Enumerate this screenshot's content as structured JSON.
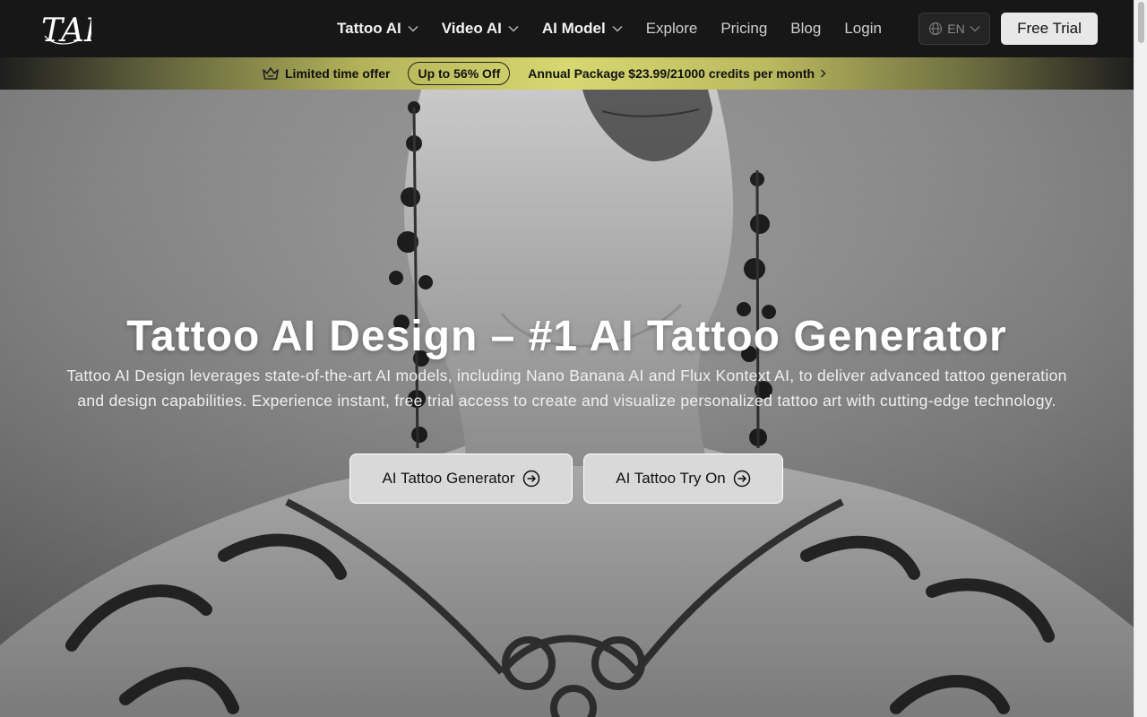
{
  "header": {
    "logo_text": "TAI",
    "nav": [
      {
        "label": "Tattoo AI",
        "has_dropdown": true
      },
      {
        "label": "Video AI",
        "has_dropdown": true
      },
      {
        "label": "AI Model",
        "has_dropdown": true
      },
      {
        "label": "Explore",
        "has_dropdown": false
      },
      {
        "label": "Pricing",
        "has_dropdown": false
      },
      {
        "label": "Blog",
        "has_dropdown": false
      },
      {
        "label": "Login",
        "has_dropdown": false
      }
    ],
    "language": "EN",
    "free_trial_label": "Free Trial"
  },
  "promo": {
    "limited_offer": "Limited time offer",
    "discount": "Up to 56% Off",
    "annual_package": "Annual Package $23.99/21000 credits per month"
  },
  "hero": {
    "title": "Tattoo AI Design – #1 AI Tattoo Generator",
    "description": "Tattoo AI Design leverages state-of-the-art AI models, including Nano Banana AI and Flux Kontext AI, to deliver advanced tattoo generation and design capabilities. Experience instant, free trial access to create and visualize personalized tattoo art with cutting-edge technology.",
    "buttons": {
      "generator": "AI Tattoo Generator",
      "try_on": "AI Tattoo Try On"
    }
  },
  "icons": {
    "crown": "crown-icon",
    "globe": "globe-icon",
    "chevron": "chevron-down-icon",
    "arrow_circle": "arrow-right-circle-icon"
  },
  "colors": {
    "header_bg": "#171717",
    "promo_accent": "#d8d871",
    "button_bg": "#d9d9d9"
  }
}
